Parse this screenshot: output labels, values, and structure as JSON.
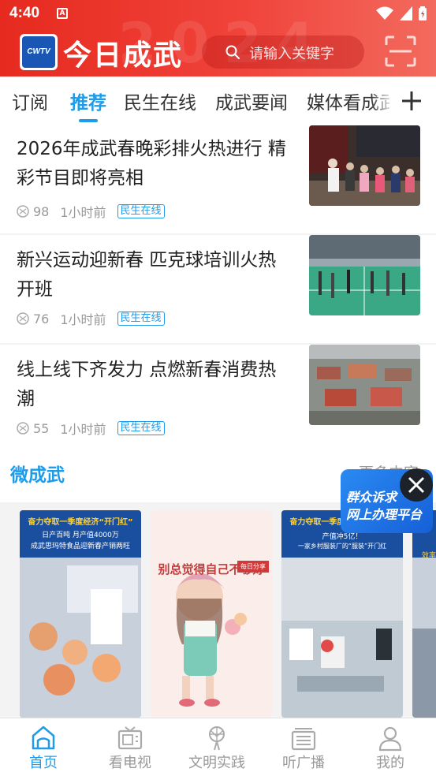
{
  "status_bar": {
    "time": "4:40",
    "notif_letter": "A"
  },
  "header": {
    "logo_short": "CWTV",
    "app_name": "今日成武",
    "watermark": "2024",
    "search_placeholder": "请输入关键字",
    "icons": {
      "search": "search-icon",
      "scan": "scan-icon"
    }
  },
  "tabs": [
    {
      "label": "订阅"
    },
    {
      "label": "推荐",
      "active": true
    },
    {
      "label": "民生在线"
    },
    {
      "label": "成武要闻"
    },
    {
      "label": "媒体看成武"
    }
  ],
  "news": [
    {
      "title": "2026年成武春晚彩排火热进行 精彩节目即将亮相",
      "views": "98",
      "time": "1小时前",
      "tag": "民生在线"
    },
    {
      "title": "新兴运动迎新春 匹克球培训火热开班",
      "views": "76",
      "time": "1小时前",
      "tag": "民生在线"
    },
    {
      "title": "线上线下齐发力  点燃新春消费热潮",
      "views": "55",
      "time": "1小时前",
      "tag": "民生在线"
    }
  ],
  "section": {
    "title": "微成武",
    "more": "更多内容"
  },
  "cards": [
    {
      "banner": "奋力夺取一季度经济“开门红”",
      "line1": "日产百吨 月产值4000万",
      "line2": "成武思玛特食品迎新春产销两旺"
    },
    {
      "headline": "别总觉得自己不够好",
      "stamp": "每日分享"
    },
    {
      "banner": "奋力夺取一季度经济“开门红”",
      "line1": "产值冲5亿！",
      "line2": "一家乡村服装厂的“服装”开门红"
    },
    {
      "banner": "效率"
    }
  ],
  "float_ad": {
    "line1": "群众诉求",
    "line2": "网上办理平台"
  },
  "bottom_nav": [
    {
      "label": "首页",
      "icon": "home-icon",
      "active": true
    },
    {
      "label": "看电视",
      "icon": "tv-icon"
    },
    {
      "label": "文明实践",
      "icon": "civilization-icon"
    },
    {
      "label": "听广播",
      "icon": "radio-icon"
    },
    {
      "label": "我的",
      "icon": "user-icon"
    }
  ],
  "colors": {
    "brand_red": "#e62a1f",
    "accent_blue": "#1e9be9"
  }
}
